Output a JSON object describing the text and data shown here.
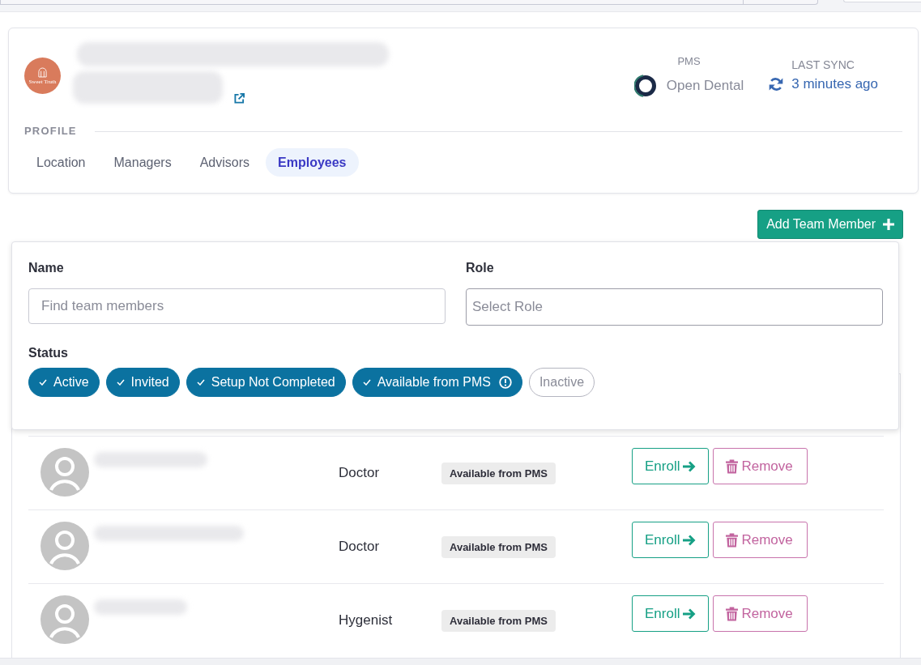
{
  "header": {
    "logo_text": "Sweet Truth",
    "pms": {
      "label": "PMS",
      "value": "Open Dental"
    },
    "last_sync": {
      "label": "LAST SYNC",
      "value": "3 minutes ago"
    }
  },
  "profile": {
    "label": "PROFILE",
    "tabs": [
      {
        "label": "Location",
        "selected": false
      },
      {
        "label": "Managers",
        "selected": false
      },
      {
        "label": "Advisors",
        "selected": false
      },
      {
        "label": "Employees",
        "selected": true
      }
    ]
  },
  "add_button": {
    "label": "Add Team Member"
  },
  "filters": {
    "name": {
      "label": "Name",
      "placeholder": "Find team members"
    },
    "role": {
      "label": "Role",
      "placeholder": "Select Role"
    },
    "status": {
      "label": "Status",
      "options": [
        {
          "label": "Active",
          "selected": true,
          "info": false
        },
        {
          "label": "Invited",
          "selected": true,
          "info": false
        },
        {
          "label": "Setup Not Completed",
          "selected": true,
          "info": false
        },
        {
          "label": "Available from PMS",
          "selected": true,
          "info": true
        },
        {
          "label": "Inactive",
          "selected": false,
          "info": false
        }
      ]
    }
  },
  "employees": [
    {
      "role": "Doctor",
      "status": "Available from PMS",
      "actions": [
        {
          "kind": "enroll",
          "label": "Enroll"
        },
        {
          "kind": "remove",
          "label": "Remove"
        }
      ]
    },
    {
      "role": "Doctor",
      "status": "Available from PMS",
      "actions": [
        {
          "kind": "enroll",
          "label": "Enroll"
        },
        {
          "kind": "remove",
          "label": "Remove"
        }
      ]
    },
    {
      "role": "Hygenist",
      "status": "Available from PMS",
      "actions": [
        {
          "kind": "enroll",
          "label": "Enroll"
        },
        {
          "kind": "remove",
          "label": "Remove"
        }
      ]
    }
  ]
}
